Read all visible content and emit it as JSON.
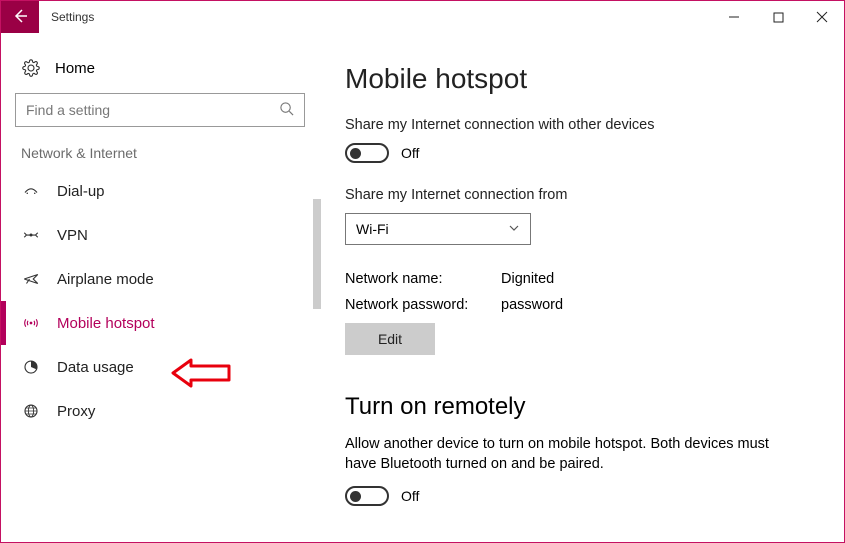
{
  "window": {
    "title": "Settings"
  },
  "sidebar": {
    "home": "Home",
    "search_placeholder": "Find a setting",
    "section": "Network & Internet",
    "items": [
      {
        "label": "Dial-up"
      },
      {
        "label": "VPN"
      },
      {
        "label": "Airplane mode"
      },
      {
        "label": "Mobile hotspot"
      },
      {
        "label": "Data usage"
      },
      {
        "label": "Proxy"
      }
    ]
  },
  "main": {
    "title": "Mobile hotspot",
    "share_label": "Share my Internet connection with other devices",
    "share_toggle_state": "Off",
    "from_label": "Share my Internet connection from",
    "from_value": "Wi-Fi",
    "network_name_key": "Network name:",
    "network_name_value": "Dignited",
    "network_password_key": "Network password:",
    "network_password_value": "password",
    "edit_button": "Edit",
    "remote_title": "Turn on remotely",
    "remote_desc": "Allow another device to turn on mobile hotspot. Both devices must have Bluetooth turned on and be paired.",
    "remote_toggle_state": "Off"
  }
}
